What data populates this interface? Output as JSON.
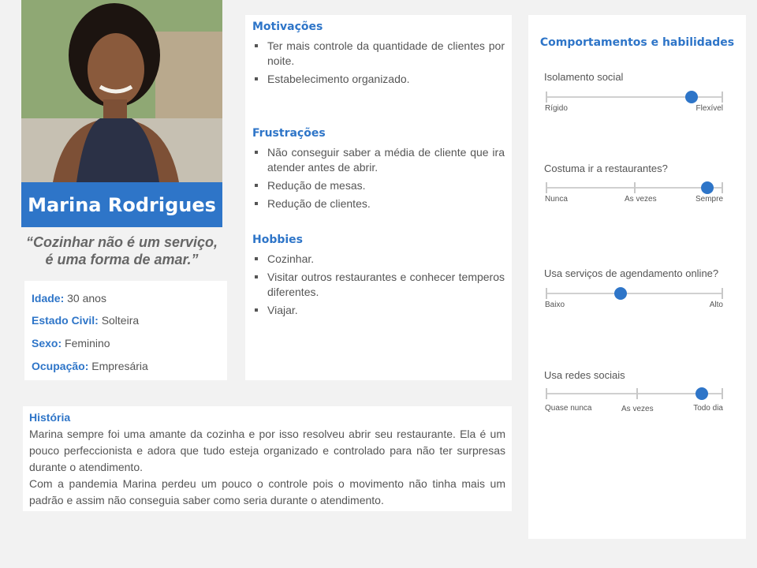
{
  "profile": {
    "name": "Marina Rodrigues",
    "quote_line1": "“Cozinhar não é um serviço,",
    "quote_line2": "é uma forma de amar.”"
  },
  "info": [
    {
      "label": "Idade:",
      "value": "30 anos"
    },
    {
      "label": "Estado Civil:",
      "value": "Solteira"
    },
    {
      "label": "Sexo:",
      "value": "Feminino"
    },
    {
      "label": "Ocupação:",
      "value": "Empresária"
    }
  ],
  "motivacoes": {
    "title": "Motivações",
    "items": [
      "Ter mais controle da quantidade de clientes por noite.",
      "Estabelecimento organizado."
    ]
  },
  "frustracoes": {
    "title": "Frustrações",
    "items": [
      "Não conseguir saber a média de cliente que ira atender antes de abrir.",
      "Redução de mesas.",
      "Redução de clientes."
    ]
  },
  "hobbies": {
    "title": "Hobbies",
    "items": [
      "Cozinhar.",
      "Visitar outros restaurantes e conhecer temperos diferentes.",
      "Viajar."
    ]
  },
  "historia": {
    "title": "História",
    "p1": "Marina sempre foi uma amante da cozinha e por isso resolveu abrir seu restaurante. Ela é um pouco perfeccionista e adora que tudo esteja organizado e controlado para não ter surpresas durante o atendimento.",
    "p2": "Com a pandemia Marina perdeu um pouco o controle pois o movimento não tinha mais um padrão e assim não conseguia saber como seria durante o atendimento."
  },
  "comportamentos": {
    "title": "Comportamentos e habilidades",
    "sliders": [
      {
        "question": "Isolamento social",
        "ticks": [
          "Rígido",
          "Flexível"
        ],
        "level": 0.82
      },
      {
        "question": "Costuma ir a restaurantes?",
        "ticks": [
          "Nunca",
          "As vezes",
          "Sempre"
        ],
        "level": 0.91
      },
      {
        "question": "Usa serviços de agendamento online?",
        "ticks": [
          "Baixo",
          "Alto"
        ],
        "level": 0.42
      },
      {
        "question": "Usa redes sociais",
        "ticks": [
          "Quase nunca",
          "As vezes",
          "Todo dia"
        ],
        "level": 0.88
      }
    ]
  },
  "colors": {
    "accent": "#2e75c8",
    "background": "#f2f2f2"
  }
}
